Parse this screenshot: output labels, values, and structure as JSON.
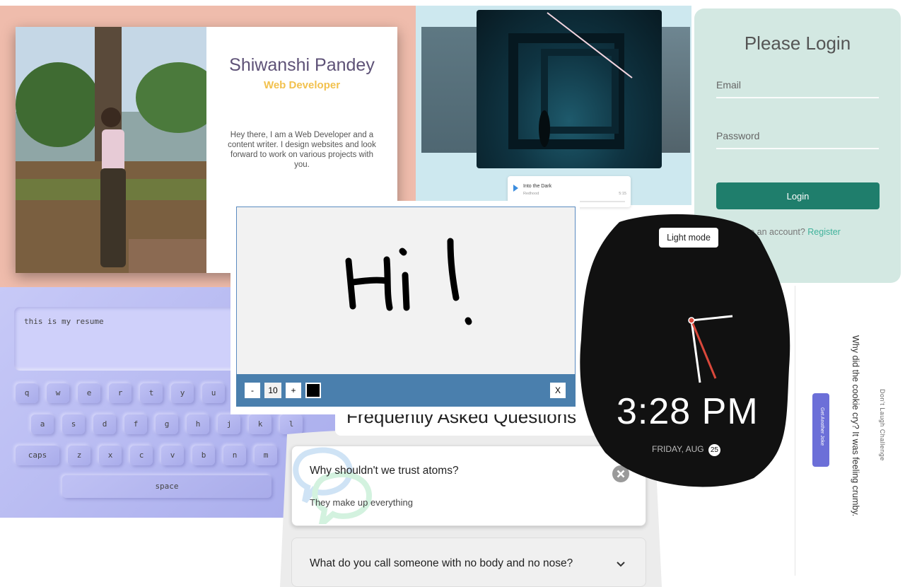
{
  "profile": {
    "name": "Shiwanshi Pandey",
    "role": "Web Developer",
    "bio": "Hey there, I am a Web Developer and a content writer. I design websites and look forward to work on various projects with you."
  },
  "music": {
    "track_title": "Into the Dark",
    "artist": "Redhood",
    "time": "5:15",
    "progress": 0.58
  },
  "login": {
    "title": "Please Login",
    "email_label": "Email",
    "password_label": "Password",
    "button": "Login",
    "footer_text": "ve an account?",
    "register_link": "Register"
  },
  "keyboard": {
    "textarea_value": "this is my resume",
    "row1": [
      "q",
      "w",
      "e",
      "r",
      "t",
      "y",
      "u"
    ],
    "row2": [
      "a",
      "s",
      "d",
      "f",
      "g",
      "h",
      "j",
      "k",
      "l"
    ],
    "row3": [
      "caps",
      "z",
      "x",
      "c",
      "v",
      "b",
      "n",
      "m"
    ],
    "space_label": "space"
  },
  "drawing": {
    "decrease_label": "-",
    "size_value": "10",
    "increase_label": "+",
    "clear_label": "X",
    "brush_color": "#000000"
  },
  "clock": {
    "mode_button": "Light mode",
    "time": "3:28 PM",
    "date_text": "FRIDAY, AUG",
    "day": "25"
  },
  "joke": {
    "title": "Don't Laugh Challenge",
    "joke_text": "Why did the cookie cry? It was feeling crumby.",
    "button": "Get Another Joke"
  },
  "faq": {
    "title": "Frequently Asked Questions",
    "items": [
      {
        "question": "Why shouldn't we trust atoms?",
        "answer": "They make up everything"
      },
      {
        "question": "What do you call someone with no body and no nose?"
      }
    ]
  }
}
